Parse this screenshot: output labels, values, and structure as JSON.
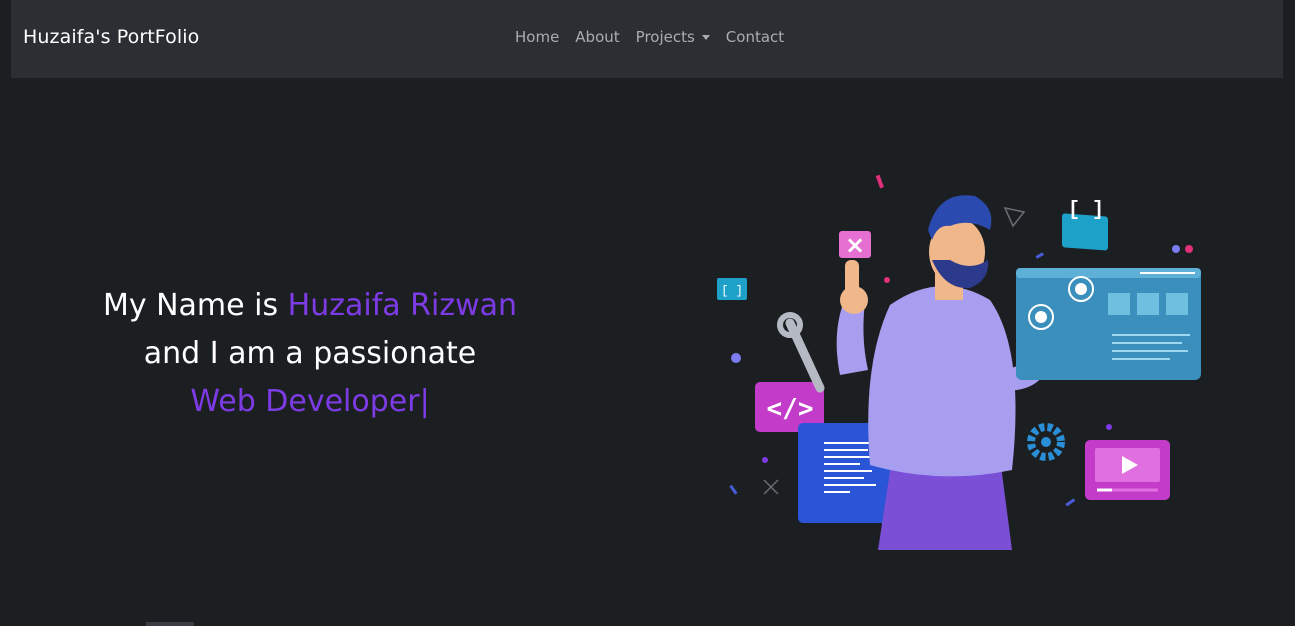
{
  "nav": {
    "brand": "Huzaifa's PortFolio",
    "links": [
      {
        "label": "Home"
      },
      {
        "label": "About"
      },
      {
        "label": "Projects",
        "dropdown": true
      },
      {
        "label": "Contact"
      }
    ]
  },
  "hero": {
    "line1_prefix": "My Name is ",
    "name": "Huzaifa Rizwan",
    "line2": "and I am a passionate",
    "role": "Web Developer",
    "cursor": "|"
  },
  "illustration": {
    "icon": "developer-illustration",
    "code_tag": "</>",
    "bracket": "[ ]",
    "close": "×"
  },
  "colors": {
    "background": "#1c1f22",
    "navbar": "#2b2f33",
    "accent": "#7d3be6",
    "nav_text": "#a9adb2"
  }
}
